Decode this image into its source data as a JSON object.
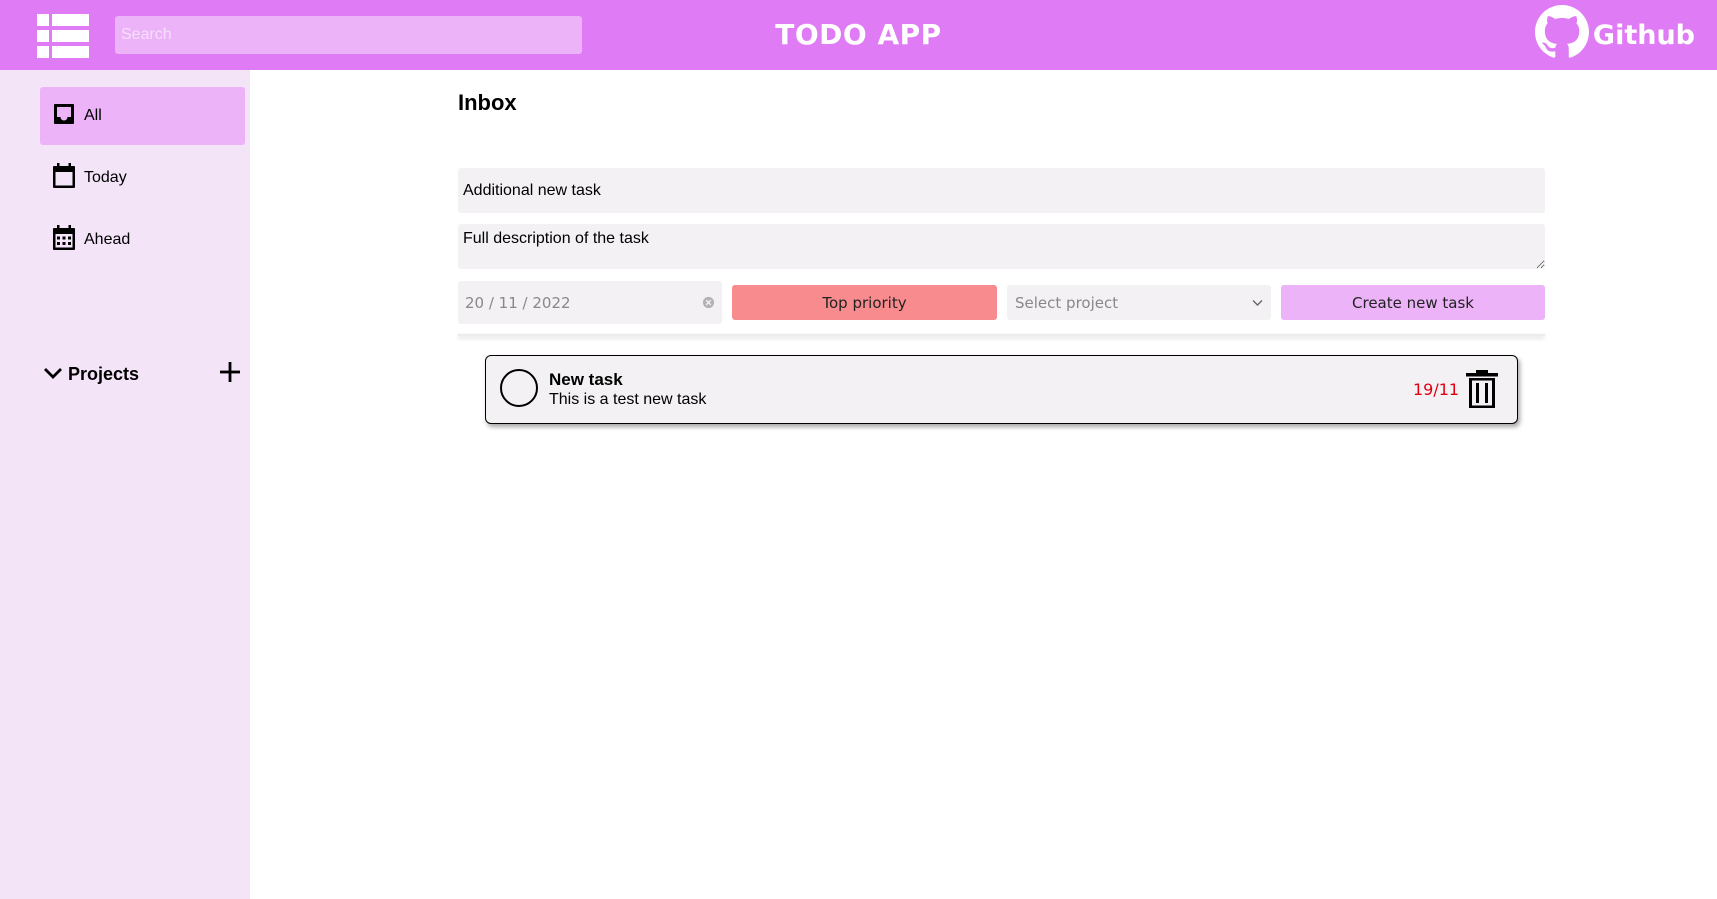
{
  "header": {
    "menu_icon": "list-menu-icon",
    "search_placeholder": "Search",
    "title": "TODO APP",
    "github_label": "Github",
    "github_icon": "github-icon",
    "colors": {
      "bar": "#df7cf5",
      "search_bg": "#ecb3f8"
    }
  },
  "sidebar": {
    "items": [
      {
        "label": "All",
        "icon": "inbox-icon",
        "active": true
      },
      {
        "label": "Today",
        "icon": "calendar-icon",
        "active": false
      },
      {
        "label": "Ahead",
        "icon": "calendar-grid-icon",
        "active": false
      }
    ],
    "projects_label": "Projects",
    "projects_toggle_icon": "chevron-down-icon",
    "add_project_icon": "plus-icon",
    "colors": {
      "bg": "#f3e4f8",
      "active_bg": "#ecb3f8"
    }
  },
  "main": {
    "title": "Inbox",
    "form": {
      "title_value": "Additional new task",
      "description_value": "Full description of the task",
      "date_value": "20 / 11 / 2022",
      "priority_label": "Top priority",
      "project_placeholder": "Select project",
      "create_label": "Create new task",
      "colors": {
        "field_bg": "#f3f1f4",
        "priority": "#f78b8e",
        "create": "#ecb3f8"
      }
    },
    "tasks": [
      {
        "name": "New task",
        "description": "This is a test new task",
        "due": "19/11",
        "due_color": "#e0000f"
      }
    ]
  }
}
